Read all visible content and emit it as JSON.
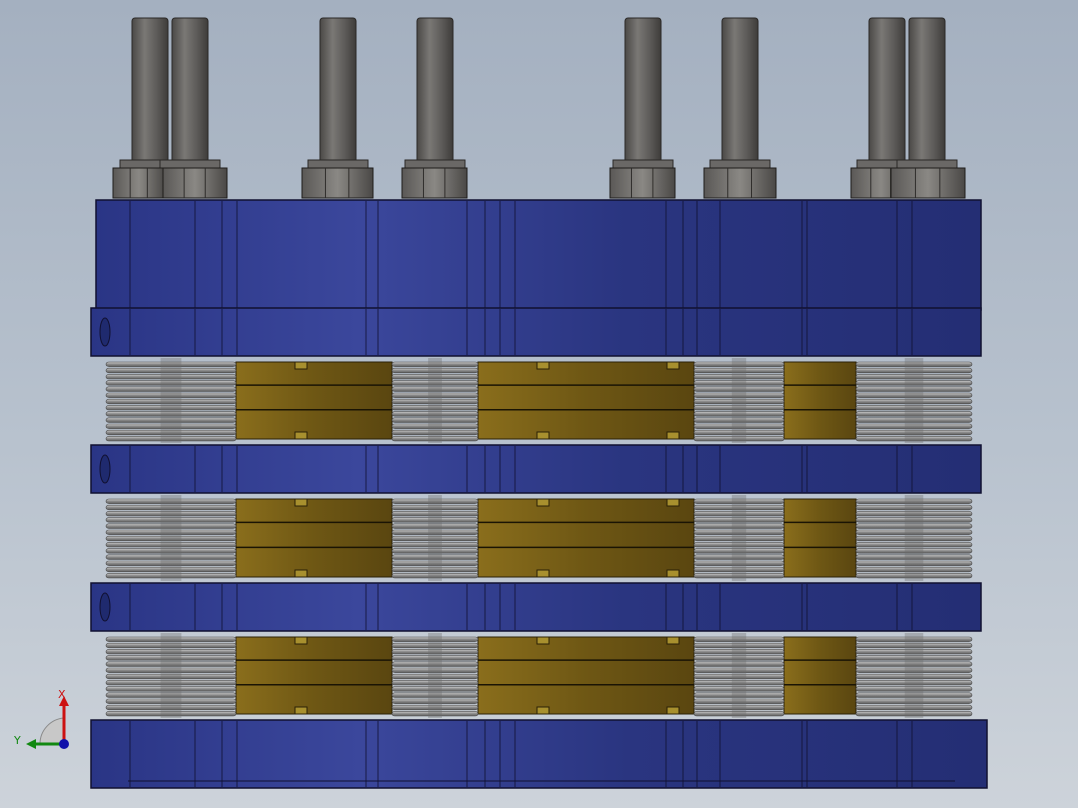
{
  "viewport": {
    "background_top": "#a4b0c0",
    "background_bottom": "#cdd3da"
  },
  "colors": {
    "plate_blue": "#2e3a8c",
    "plate_blue_dark": "#1f2a6e",
    "plate_blue_light": "#3e4ca4",
    "bolt_gray": "#5c5a58",
    "spring_gray": "#9a9a9a",
    "cell_gold": "#7a621a",
    "cell_gold_dark": "#5e4b12",
    "edge": "#101030"
  },
  "triad": {
    "x_label": "X",
    "y_label": "Y",
    "x_color": "#cc1111",
    "y_color": "#118811",
    "z_color": "#1111aa",
    "icon": "axis-triad-icon"
  }
}
